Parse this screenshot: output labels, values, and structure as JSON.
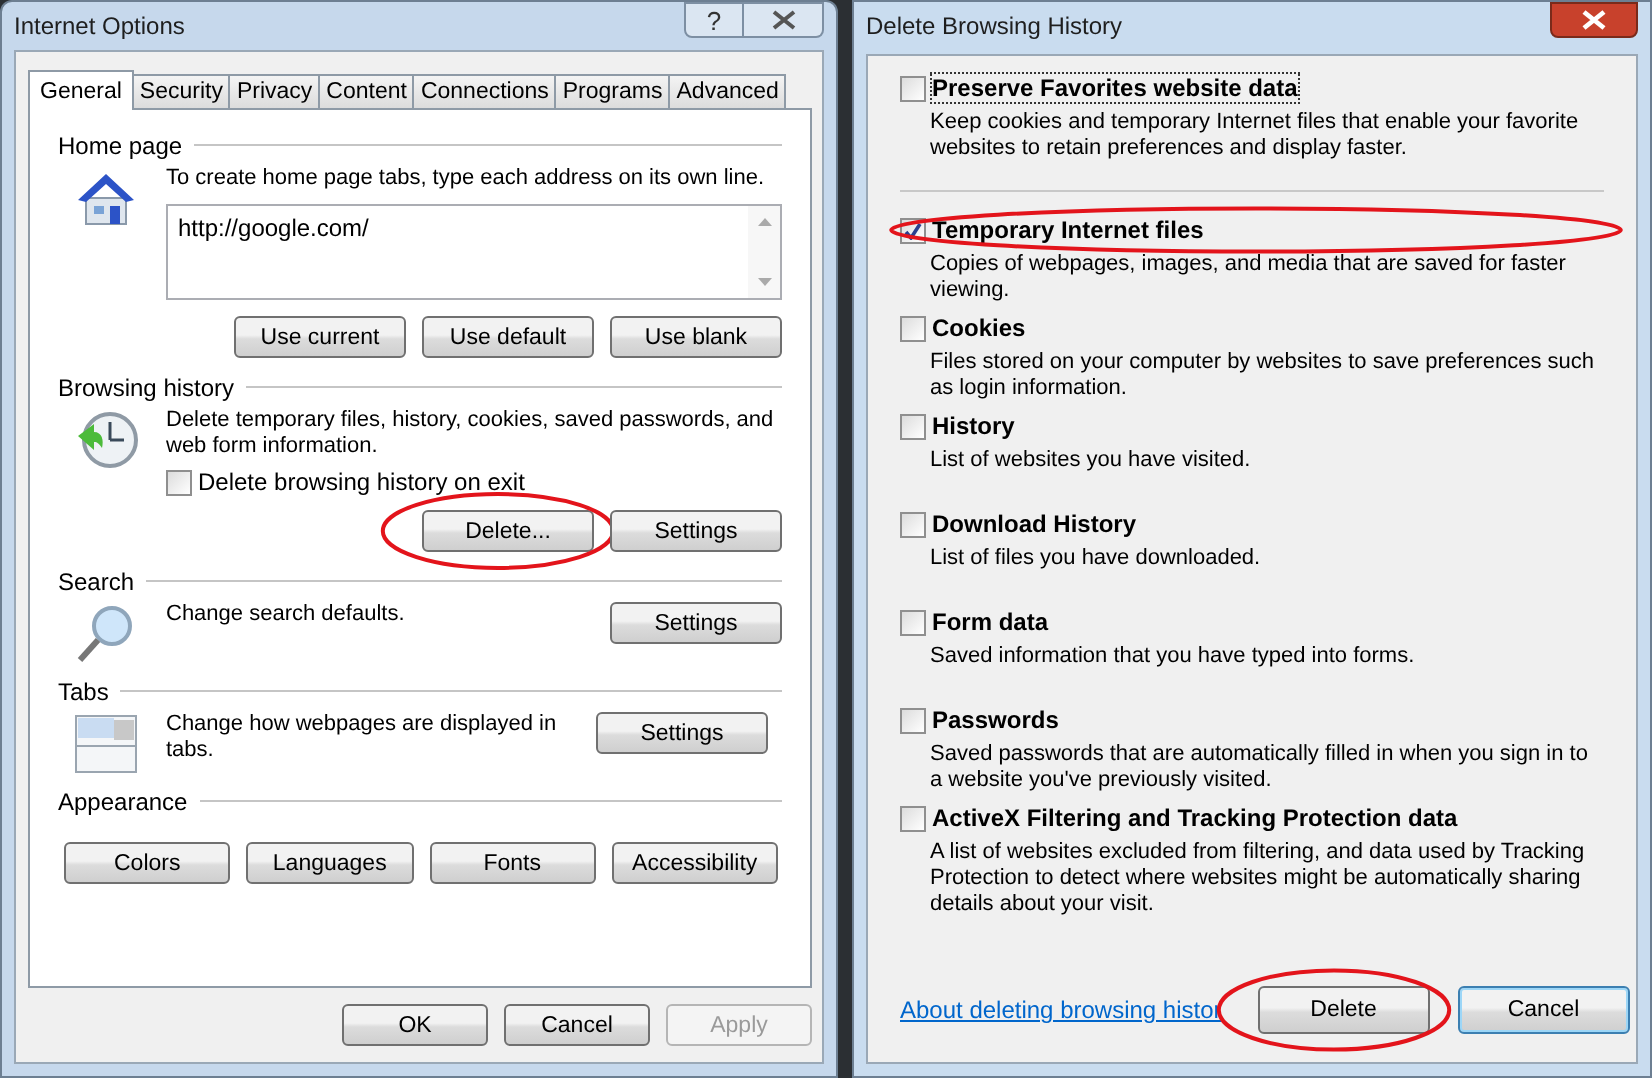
{
  "internet_options": {
    "title": "Internet Options",
    "help_button": "?",
    "tabs": [
      {
        "label": "General",
        "selected": true
      },
      {
        "label": "Security",
        "selected": false
      },
      {
        "label": "Privacy",
        "selected": false
      },
      {
        "label": "Content",
        "selected": false
      },
      {
        "label": "Connections",
        "selected": false
      },
      {
        "label": "Programs",
        "selected": false
      },
      {
        "label": "Advanced",
        "selected": false
      }
    ],
    "home_page": {
      "legend": "Home page",
      "description": "To create home page tabs, type each address on its own line.",
      "addresses": "http://google.com/",
      "buttons": [
        {
          "label": "Use current",
          "circled": false
        },
        {
          "label": "Use default",
          "circled": false
        },
        {
          "label": "Use blank",
          "circled": false
        }
      ]
    },
    "browsing_history": {
      "legend": "Browsing history",
      "description": "Delete temporary files, history, cookies, saved passwords, and web form information.",
      "checkbox": {
        "label": "Delete browsing history on exit",
        "checked": false
      },
      "buttons": [
        {
          "label": "Delete...",
          "circled": true
        },
        {
          "label": "Settings",
          "circled": false
        }
      ]
    },
    "search": {
      "legend": "Search",
      "description": "Change search defaults.",
      "button": "Settings"
    },
    "tabs_section": {
      "legend": "Tabs",
      "description": "Change how webpages are displayed in tabs.",
      "button": "Settings"
    },
    "appearance": {
      "legend": "Appearance",
      "buttons": [
        "Colors",
        "Languages",
        "Fonts",
        "Accessibility"
      ]
    },
    "footer_buttons": [
      {
        "label": "OK",
        "disabled": false
      },
      {
        "label": "Cancel",
        "disabled": false
      },
      {
        "label": "Apply",
        "disabled": true
      }
    ]
  },
  "delete_browsing_history": {
    "title": "Delete Browsing History",
    "preserve": {
      "label": "Preserve Favorites website data",
      "description": "Keep cookies and temporary Internet files that enable your favorite websites to retain preferences and display faster.",
      "checked": false,
      "circled": false
    },
    "categories": [
      {
        "label": "Temporary Internet files",
        "description": "Copies of webpages, images, and media that are saved for faster viewing.",
        "checked": true,
        "circled": true
      },
      {
        "label": "Cookies",
        "description": "Files stored on your computer by websites to save preferences such as login information.",
        "checked": false,
        "circled": false
      },
      {
        "label": "History",
        "description": "List of websites you have visited.",
        "checked": false,
        "circled": false
      },
      {
        "label": "Download History",
        "description": "List of files you have downloaded.",
        "checked": false,
        "circled": false
      },
      {
        "label": "Form data",
        "description": "Saved information that you have typed into forms.",
        "checked": false,
        "circled": false
      },
      {
        "label": "Passwords",
        "description": "Saved passwords that are automatically filled in when you sign in to a website you've previously visited.",
        "checked": false,
        "circled": false
      },
      {
        "label": "ActiveX Filtering and Tracking Protection data",
        "description": "A list of websites excluded from filtering, and data used by Tracking Protection to detect where websites might be automatically sharing details about your visit.",
        "checked": false,
        "circled": false
      }
    ],
    "link": "About deleting browsing histor",
    "buttons": [
      {
        "label": "Delete",
        "circled": true,
        "focused": false
      },
      {
        "label": "Cancel",
        "circled": false,
        "focused": true
      }
    ]
  }
}
